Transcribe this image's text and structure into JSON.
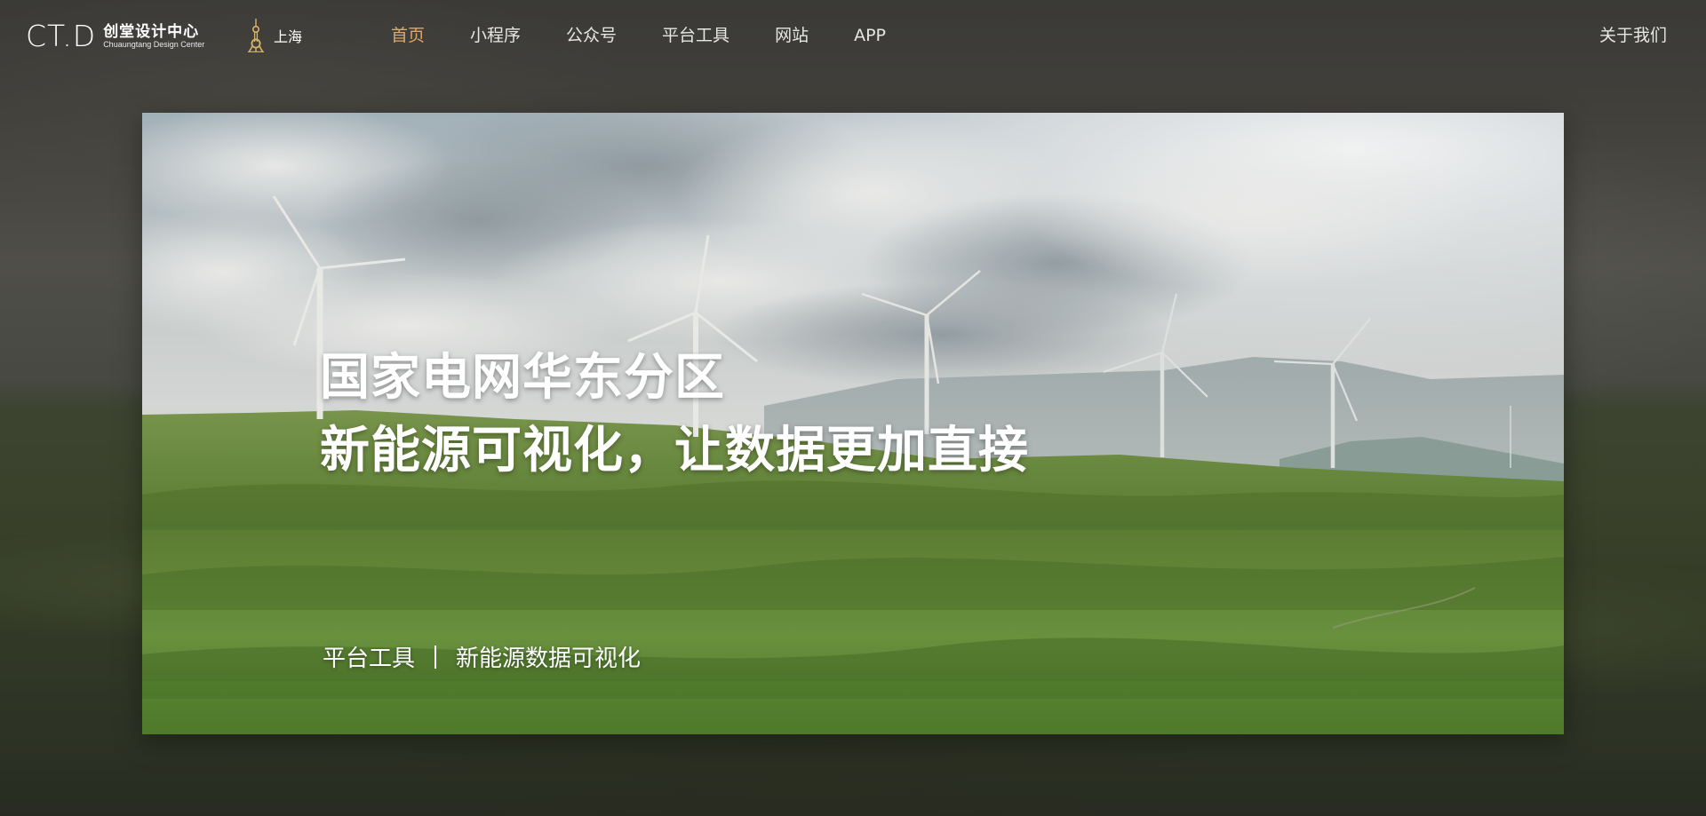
{
  "brand": {
    "mark": "CT.D",
    "name_cn": "创堂设计中心",
    "name_en": "Chuaungtang Design Center"
  },
  "location": {
    "icon": "oriental-pearl-tower-icon",
    "city": "上海"
  },
  "nav": {
    "items": [
      {
        "label": "首页",
        "active": true
      },
      {
        "label": "小程序",
        "active": false
      },
      {
        "label": "公众号",
        "active": false
      },
      {
        "label": "平台工具",
        "active": false
      },
      {
        "label": "网站",
        "active": false
      },
      {
        "label": "APP",
        "active": false
      }
    ],
    "about": "关于我们"
  },
  "hero": {
    "title_line1": "国家电网华东分区",
    "title_line2": "新能源可视化，让数据更加直接",
    "category": "平台工具",
    "subtitle": "新能源数据可视化"
  },
  "colors": {
    "accent": "#e0a868",
    "nav_text": "#e6e6e2",
    "hero_text": "#ffffff"
  }
}
